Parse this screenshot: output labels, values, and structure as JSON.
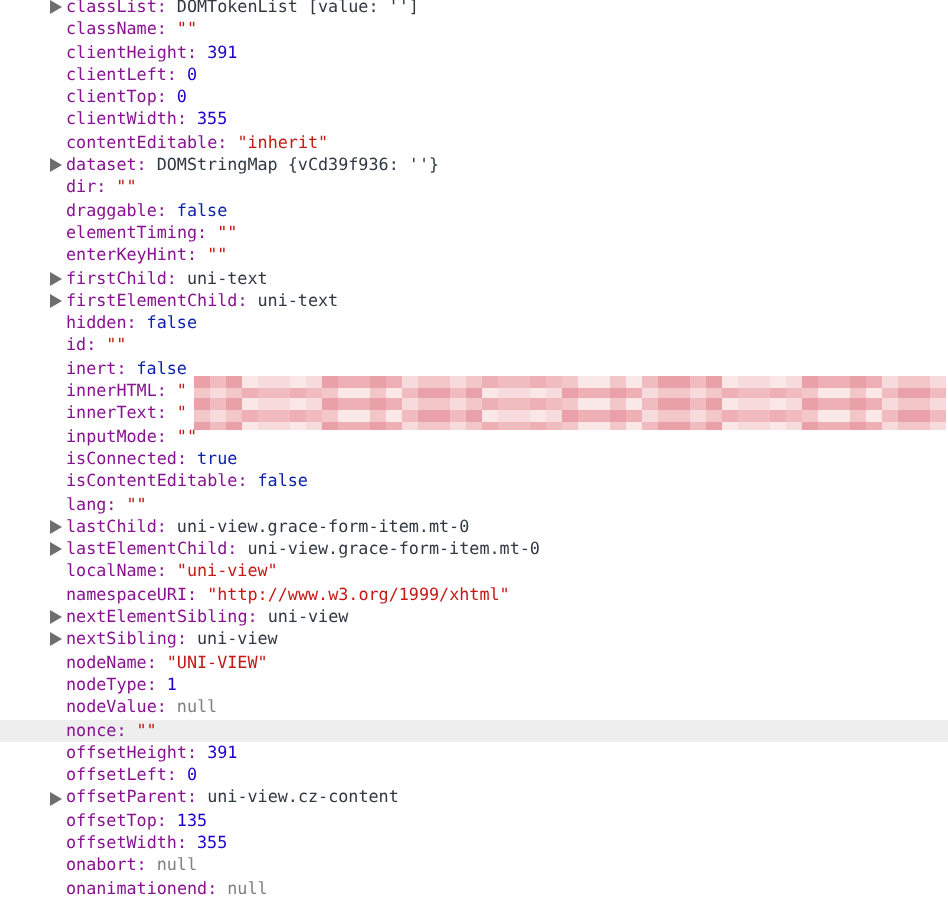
{
  "properties": [
    {
      "key": "classList:",
      "value": "DOMTokenList [value: '']",
      "kind": "object",
      "expandable": true
    },
    {
      "key": "className:",
      "value": "\"\"",
      "kind": "string",
      "expandable": false
    },
    {
      "key": "clientHeight:",
      "value": "391",
      "kind": "number",
      "expandable": false
    },
    {
      "key": "clientLeft:",
      "value": "0",
      "kind": "number",
      "expandable": false
    },
    {
      "key": "clientTop:",
      "value": "0",
      "kind": "number",
      "expandable": false
    },
    {
      "key": "clientWidth:",
      "value": "355",
      "kind": "number",
      "expandable": false
    },
    {
      "key": "contentEditable:",
      "value": "\"inherit\"",
      "kind": "string",
      "expandable": false
    },
    {
      "key": "dataset:",
      "value": "DOMStringMap {vCd39f936: ''}",
      "kind": "object",
      "expandable": true
    },
    {
      "key": "dir:",
      "value": "\"\"",
      "kind": "string",
      "expandable": false
    },
    {
      "key": "draggable:",
      "value": "false",
      "kind": "keyword",
      "expandable": false
    },
    {
      "key": "elementTiming:",
      "value": "\"\"",
      "kind": "string",
      "expandable": false
    },
    {
      "key": "enterKeyHint:",
      "value": "\"\"",
      "kind": "string",
      "expandable": false
    },
    {
      "key": "firstChild:",
      "value": "uni-text",
      "kind": "object",
      "expandable": true
    },
    {
      "key": "firstElementChild:",
      "value": "uni-text",
      "kind": "object",
      "expandable": true
    },
    {
      "key": "hidden:",
      "value": "false",
      "kind": "keyword",
      "expandable": false
    },
    {
      "key": "id:",
      "value": "\"\"",
      "kind": "string",
      "expandable": false
    },
    {
      "key": "inert:",
      "value": "false",
      "kind": "keyword",
      "expandable": false
    },
    {
      "key": "innerHTML:",
      "value": "\"",
      "kind": "string",
      "expandable": false,
      "redacted": true
    },
    {
      "key": "innerText:",
      "value": "\"",
      "kind": "string",
      "expandable": false,
      "redacted": true
    },
    {
      "key": "inputMode:",
      "value": "\"\"",
      "kind": "string",
      "expandable": false
    },
    {
      "key": "isConnected:",
      "value": "true",
      "kind": "keyword",
      "expandable": false
    },
    {
      "key": "isContentEditable:",
      "value": "false",
      "kind": "keyword",
      "expandable": false
    },
    {
      "key": "lang:",
      "value": "\"\"",
      "kind": "string",
      "expandable": false
    },
    {
      "key": "lastChild:",
      "value": "uni-view.grace-form-item.mt-0",
      "kind": "object",
      "expandable": true
    },
    {
      "key": "lastElementChild:",
      "value": "uni-view.grace-form-item.mt-0",
      "kind": "object",
      "expandable": true
    },
    {
      "key": "localName:",
      "value": "\"uni-view\"",
      "kind": "string",
      "expandable": false
    },
    {
      "key": "namespaceURI:",
      "value": "\"http://www.w3.org/1999/xhtml\"",
      "kind": "string",
      "expandable": false
    },
    {
      "key": "nextElementSibling:",
      "value": "uni-view",
      "kind": "object",
      "expandable": true
    },
    {
      "key": "nextSibling:",
      "value": "uni-view",
      "kind": "object",
      "expandable": true
    },
    {
      "key": "nodeName:",
      "value": "\"UNI-VIEW\"",
      "kind": "string",
      "expandable": false
    },
    {
      "key": "nodeType:",
      "value": "1",
      "kind": "number",
      "expandable": false
    },
    {
      "key": "nodeValue:",
      "value": "null",
      "kind": "null",
      "expandable": false
    },
    {
      "key": "nonce:",
      "value": "\"\"",
      "kind": "string",
      "expandable": false,
      "highlighted": true
    },
    {
      "key": "offsetHeight:",
      "value": "391",
      "kind": "number",
      "expandable": false
    },
    {
      "key": "offsetLeft:",
      "value": "0",
      "kind": "number",
      "expandable": false
    },
    {
      "key": "offsetParent:",
      "value": "uni-view.cz-content",
      "kind": "object",
      "expandable": true
    },
    {
      "key": "offsetTop:",
      "value": "135",
      "kind": "number",
      "expandable": false
    },
    {
      "key": "offsetWidth:",
      "value": "355",
      "kind": "number",
      "expandable": false
    },
    {
      "key": "onabort:",
      "value": "null",
      "kind": "null",
      "expandable": false
    },
    {
      "key": "onanimationend:",
      "value": "null",
      "kind": "null",
      "expandable": false
    }
  ]
}
